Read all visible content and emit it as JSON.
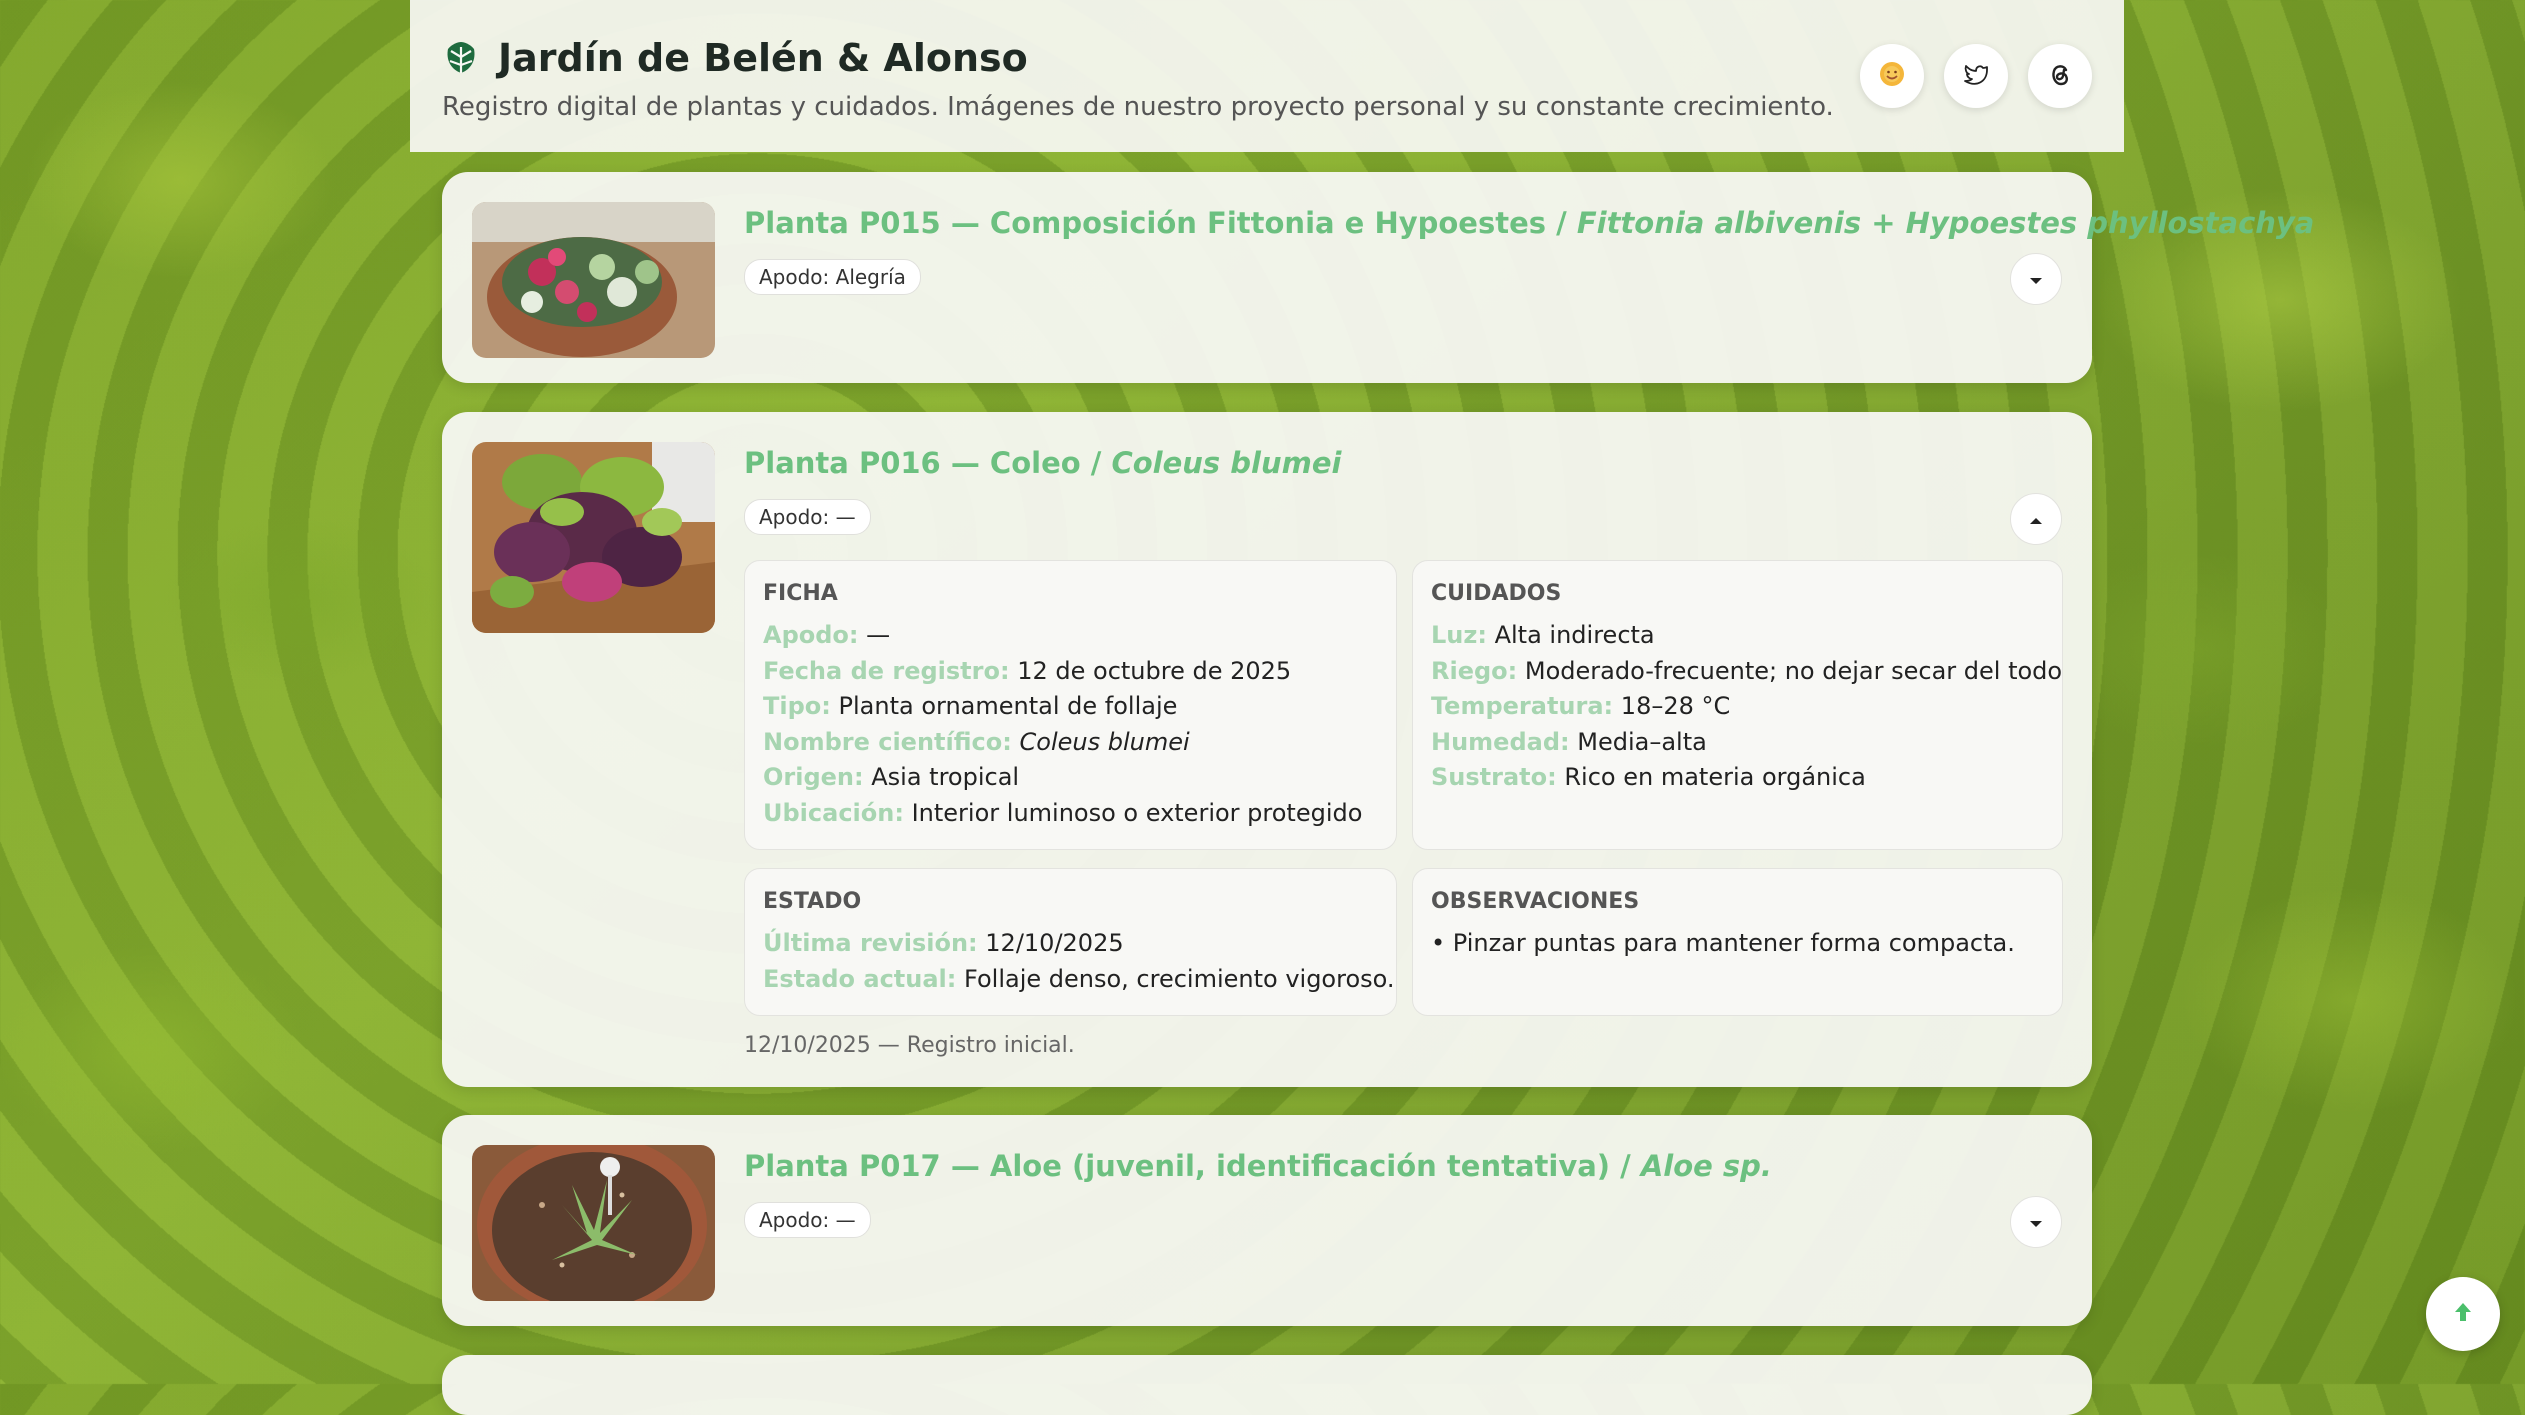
{
  "header": {
    "title": "Jardín de Belén & Alonso",
    "subtitle": "Registro digital de plantas y cuidados. Imágenes de nuestro proyecto personal y su constante crecimiento.",
    "logo_icon": "monstera-leaf-icon",
    "social": [
      "sun-face-icon",
      "twitter-bird-icon",
      "threads-icon"
    ]
  },
  "plants": [
    {
      "title_prefix": "Planta P015 — Composición Fittonia e Hypoestes / ",
      "scientific": "Fittonia albivenis + Hypoestes phyllostachya",
      "apodo": "Apodo: Alegría",
      "expanded": false
    },
    {
      "title_prefix": "Planta P016 — Coleo / ",
      "scientific": "Coleus blumei",
      "apodo": "Apodo: —",
      "expanded": true,
      "ficha": {
        "title": "FICHA",
        "rows": [
          {
            "k": "Apodo:",
            "v": "—"
          },
          {
            "k": "Fecha de registro:",
            "v": "12 de octubre de 2025"
          },
          {
            "k": "Tipo:",
            "v": "Planta ornamental de follaje"
          },
          {
            "k": "Nombre científico:",
            "v": "Coleus blumei"
          },
          {
            "k": "Origen:",
            "v": "Asia tropical"
          },
          {
            "k": "Ubicación:",
            "v": "Interior luminoso o exterior protegido"
          }
        ]
      },
      "cuidados": {
        "title": "CUIDADOS",
        "rows": [
          {
            "k": "Luz:",
            "v": "Alta indirecta"
          },
          {
            "k": "Riego:",
            "v": "Moderado-frecuente; no dejar secar del todo"
          },
          {
            "k": "Temperatura:",
            "v": "18–28 °C"
          },
          {
            "k": "Humedad:",
            "v": "Media–alta"
          },
          {
            "k": "Sustrato:",
            "v": "Rico en materia orgánica"
          }
        ]
      },
      "estado": {
        "title": "ESTADO",
        "rows": [
          {
            "k": "Última revisión:",
            "v": "12/10/2025"
          },
          {
            "k": "Estado actual:",
            "v": "Follaje denso, crecimiento vigoroso."
          }
        ]
      },
      "observaciones": {
        "title": "OBSERVACIONES",
        "text": "• Pinzar puntas para mantener forma compacta."
      },
      "log": "12/10/2025 — Registro inicial."
    },
    {
      "title_prefix": "Planta P017 — Aloe (juvenil, identificación tentativa) / ",
      "scientific": "Aloe sp.",
      "apodo": "Apodo: —",
      "expanded": false
    }
  ],
  "colors": {
    "accent_title": "#6cc080",
    "label": "#a7d5b1",
    "fab_arrow": "#4bbf6b"
  }
}
